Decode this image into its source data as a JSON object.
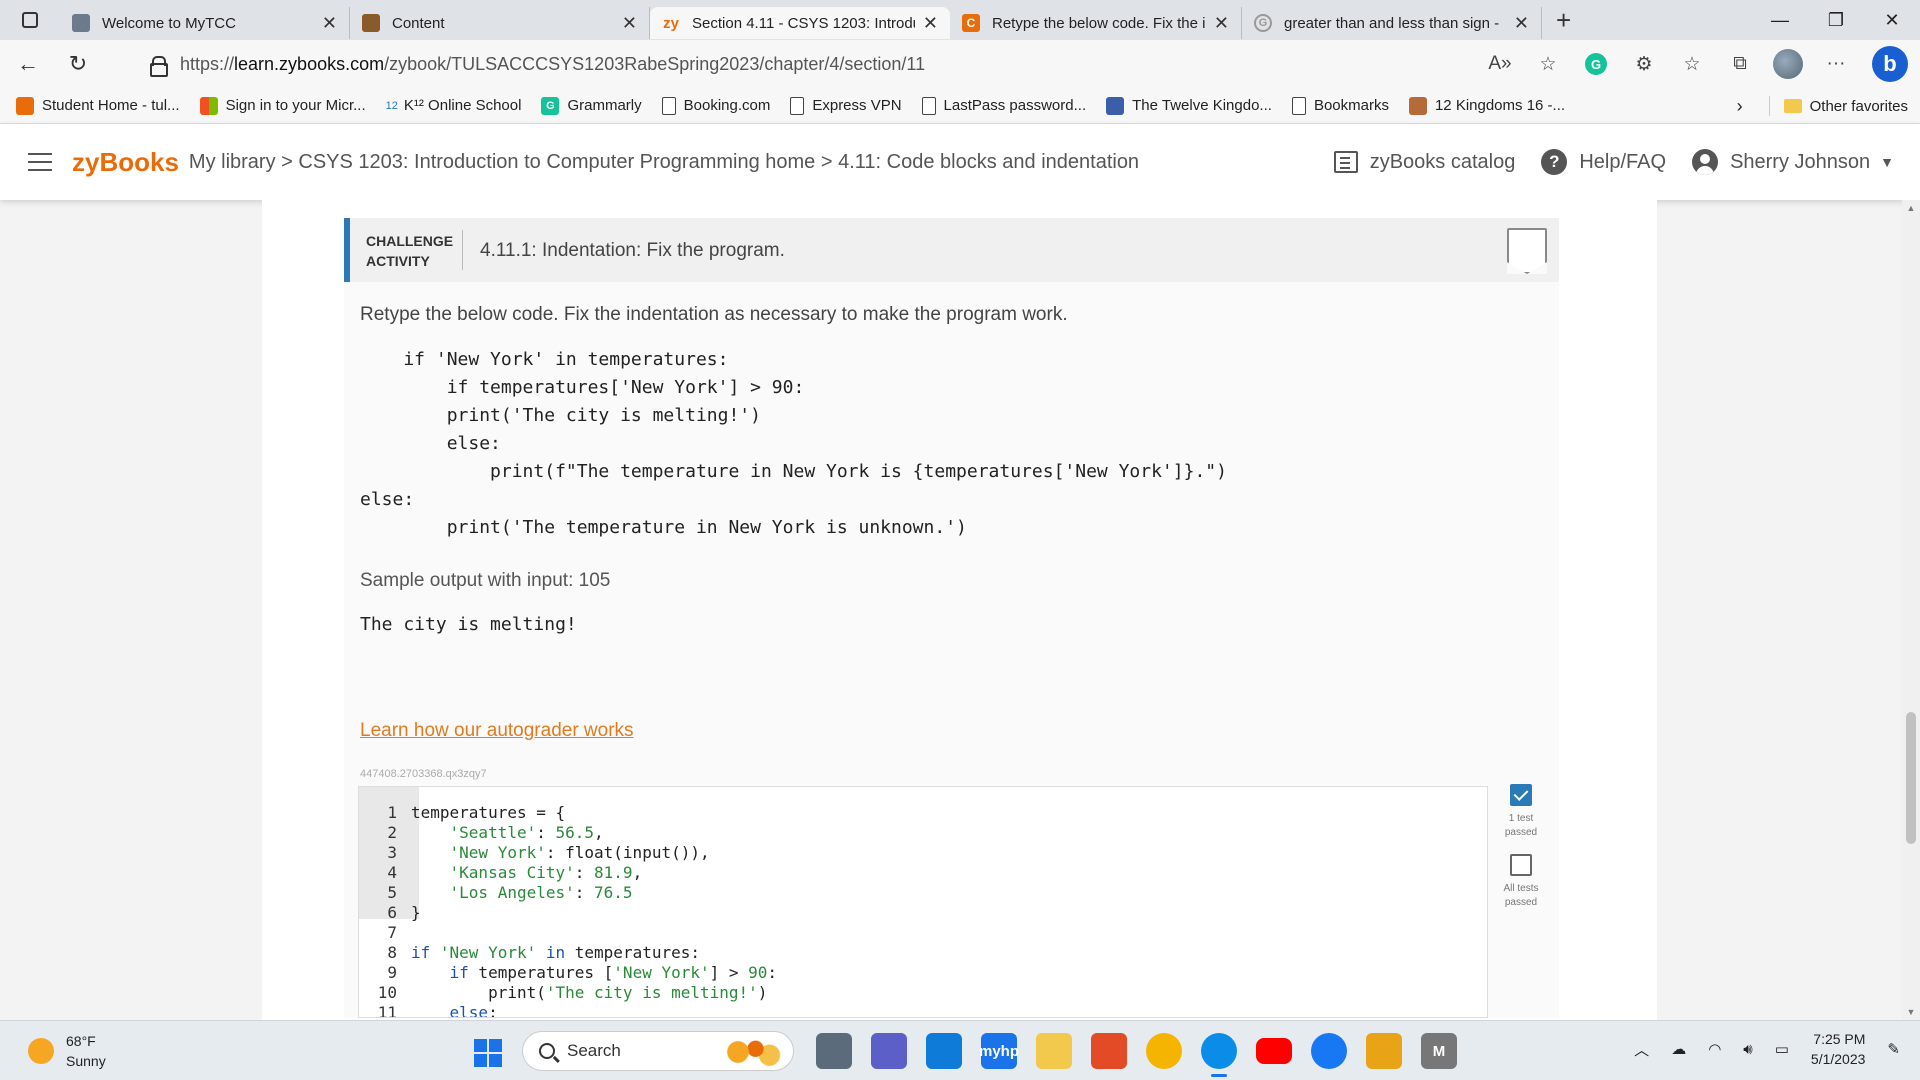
{
  "browser": {
    "tabs": [
      {
        "title": "Welcome to MyTCC",
        "favicon_color": "#6b7b8c",
        "active": false
      },
      {
        "title": "Content",
        "favicon_color": "#8a5a2b",
        "active": false
      },
      {
        "title": "Section 4.11 - CSYS 1203: Introdu",
        "favicon_text": "zy",
        "favicon_color": "#e86d0a",
        "active": true
      },
      {
        "title": "Retype the below code. Fix the in",
        "favicon_text": "C",
        "favicon_color": "#e86d0a",
        "active": false
      },
      {
        "title": "greater than and less than sign -",
        "favicon_text": "G",
        "favicon_color": "#999999",
        "active": false
      }
    ],
    "url_prefix": "https://",
    "url_domain": "learn.zybooks.com",
    "url_path": "/zybook/TULSACCCSYS1203RabeSpring2023/chapter/4/section/11",
    "favorites": [
      {
        "label": "Student Home - tul...",
        "icon": "grid-icon",
        "color": "#e86d0a"
      },
      {
        "label": "Sign in to your Micr...",
        "icon": "microsoft-icon",
        "color": "#f25022"
      },
      {
        "label": "K¹² Online School",
        "icon": "k12-icon",
        "color": "#2a7ab8",
        "prefix": "12"
      },
      {
        "label": "Grammarly",
        "icon": "grammarly-icon",
        "color": "#15c39a"
      },
      {
        "label": "Booking.com",
        "icon": "page-icon"
      },
      {
        "label": "Express VPN",
        "icon": "page-icon"
      },
      {
        "label": "LastPass password...",
        "icon": "page-icon"
      },
      {
        "label": "The Twelve Kingdo...",
        "icon": "kingdom-icon",
        "color": "#3a5fa8"
      },
      {
        "label": "Bookmarks",
        "icon": "page-icon"
      },
      {
        "label": "12 Kingdoms 16 -...",
        "icon": "thumbnail-icon",
        "color": "#b56a3a"
      }
    ],
    "other_favorites": "Other favorites"
  },
  "zybooks": {
    "logo": "zyBooks",
    "breadcrumb": "My library > CSYS 1203: Introduction to Computer Programming home > 4.11: Code blocks and indentation",
    "catalog": "zyBooks catalog",
    "help": "Help/FAQ",
    "user": "Sherry Johnson"
  },
  "activity": {
    "label_line1": "CHALLENGE",
    "label_line2": "ACTIVITY",
    "title": "4.11.1: Indentation: Fix the program.",
    "instructions": "Retype the below code. Fix the indentation as necessary to make the program work.",
    "code": "    if 'New York' in temperatures:\n        if temperatures['New York'] > 90:\n        print('The city is melting!')\n        else:\n            print(f\"The temperature in New York is {temperatures['New York']}.\")\nelse:\n        print('The temperature in New York is unknown.')",
    "sample_label": "Sample output with input: 105",
    "sample_output": "The city is melting!",
    "autograder_link": "Learn how our autograder works",
    "exercise_id": "447408.2703368.qx3zqy7",
    "editor_lines": [
      {
        "n": "1",
        "code": "temperatures = {"
      },
      {
        "n": "2",
        "code": "    'Seattle': 56.5,"
      },
      {
        "n": "3",
        "code": "    'New York': float(input()),"
      },
      {
        "n": "4",
        "code": "    'Kansas City': 81.9,"
      },
      {
        "n": "5",
        "code": "    'Los Angeles': 76.5"
      },
      {
        "n": "6",
        "code": "}"
      },
      {
        "n": "7",
        "code": ""
      },
      {
        "n": "8",
        "code": "if 'New York' in temperatures:"
      },
      {
        "n": "9",
        "code": "    if temperatures ['New York'] > 90:"
      },
      {
        "n": "10",
        "code": "        print('The city is melting!')"
      },
      {
        "n": "11",
        "code": "    else:"
      }
    ],
    "test1_line1": "1 test",
    "test1_line2": "passed",
    "test2_line1": "All tests",
    "test2_line2": "passed",
    "test1_checked": true,
    "test2_checked": false
  },
  "taskbar": {
    "temperature": "68°F",
    "condition": "Sunny",
    "search_placeholder": "Search",
    "time": "7:25 PM",
    "date": "5/1/2023",
    "apps": [
      {
        "name": "file-manager-icon",
        "color": "#5b6b7b"
      },
      {
        "name": "teams-icon",
        "color": "#5b5fc7"
      },
      {
        "name": "store-icon",
        "color": "#0f7bd8"
      },
      {
        "name": "myhp-icon",
        "color": "#1a73e8",
        "text": "myhp"
      },
      {
        "name": "folder-icon",
        "color": "#f2c94c"
      },
      {
        "name": "office-icon",
        "color": "#e34b27"
      },
      {
        "name": "norton-icon",
        "color": "#f5b400"
      },
      {
        "name": "edge-icon",
        "color": "#0c8ce9",
        "active": true
      },
      {
        "name": "youtube-icon",
        "color": "#ff0000"
      },
      {
        "name": "facebook-icon",
        "color": "#1877f2"
      },
      {
        "name": "coin-icon",
        "color": "#e8a317"
      },
      {
        "name": "m-app-icon",
        "color": "#777777",
        "text": "M"
      }
    ]
  }
}
